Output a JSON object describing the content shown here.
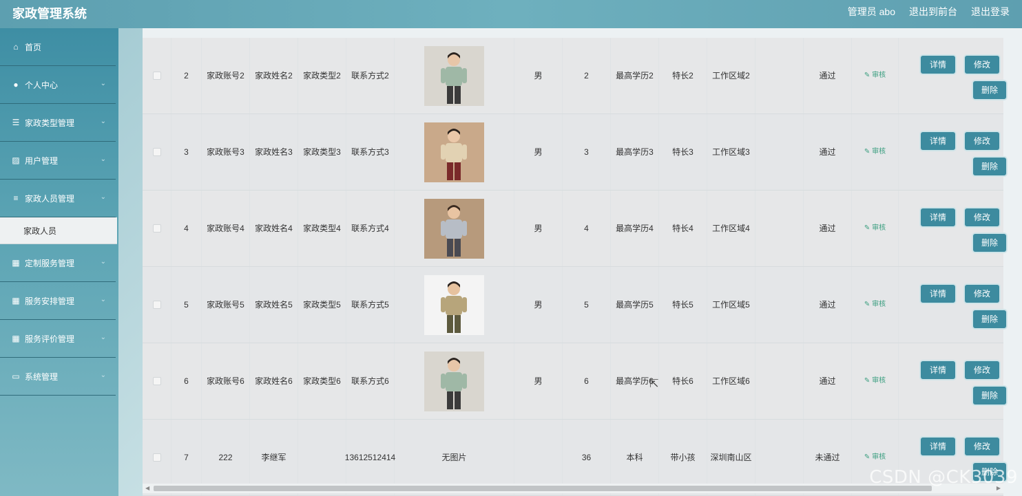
{
  "header": {
    "app_title": "家政管理系统",
    "links": [
      "管理员 abo",
      "退出到前台",
      "退出登录"
    ]
  },
  "sidebar": {
    "items": [
      {
        "label": "首页",
        "icon": "home-icon",
        "glyph": "⌂",
        "chev": false
      },
      {
        "label": "个人中心",
        "icon": "user-icon",
        "glyph": "●",
        "chev": true
      },
      {
        "label": "家政类型管理",
        "icon": "list-icon",
        "glyph": "☰",
        "chev": true
      },
      {
        "label": "用户管理",
        "icon": "chart-icon",
        "glyph": "▨",
        "chev": true
      },
      {
        "label": "家政人员管理",
        "icon": "sliders-icon",
        "glyph": "≡",
        "chev": true
      }
    ],
    "sub_item": "家政人员",
    "items2": [
      {
        "label": "定制服务管理",
        "icon": "grid-icon",
        "glyph": "▦",
        "chev": true
      },
      {
        "label": "服务安排管理",
        "icon": "grid-icon",
        "glyph": "▦",
        "chev": true
      },
      {
        "label": "服务评价管理",
        "icon": "grid-icon",
        "glyph": "▦",
        "chev": true
      },
      {
        "label": "系统管理",
        "icon": "monitor-icon",
        "glyph": "▭",
        "chev": true
      }
    ]
  },
  "table": {
    "audit_label": "✎ 审核",
    "buttons": {
      "detail": "详情",
      "edit": "修改",
      "delete": "删除"
    },
    "rows": [
      {
        "idx": "2",
        "account": [
          "家政账号",
          "2"
        ],
        "name": [
          "家政姓名",
          "2"
        ],
        "type": [
          "家政类型",
          "2"
        ],
        "phone": [
          "联系方式",
          "2"
        ],
        "photo": "p1",
        "gender": "男",
        "age": "2",
        "edu": [
          "最高学历",
          "2"
        ],
        "spec": "特长2",
        "area": [
          "工作区域",
          "2"
        ],
        "status": "通过"
      },
      {
        "idx": "3",
        "account": [
          "家政账号",
          "3"
        ],
        "name": [
          "家政姓名",
          "3"
        ],
        "type": [
          "家政类型",
          "3"
        ],
        "phone": [
          "联系方式",
          "3"
        ],
        "photo": "p2",
        "gender": "男",
        "age": "3",
        "edu": [
          "最高学历",
          "3"
        ],
        "spec": "特长3",
        "area": [
          "工作区域",
          "3"
        ],
        "status": "通过"
      },
      {
        "idx": "4",
        "account": [
          "家政账号",
          "4"
        ],
        "name": [
          "家政姓名",
          "4"
        ],
        "type": [
          "家政类型",
          "4"
        ],
        "phone": [
          "联系方式",
          "4"
        ],
        "photo": "p3",
        "gender": "男",
        "age": "4",
        "edu": [
          "最高学历",
          "4"
        ],
        "spec": "特长4",
        "area": [
          "工作区域",
          "4"
        ],
        "status": "通过"
      },
      {
        "idx": "5",
        "account": [
          "家政账号",
          "5"
        ],
        "name": [
          "家政姓名",
          "5"
        ],
        "type": [
          "家政类型",
          "5"
        ],
        "phone": [
          "联系方式",
          "5"
        ],
        "photo": "p4",
        "gender": "男",
        "age": "5",
        "edu": [
          "最高学历",
          "5"
        ],
        "spec": "特长5",
        "area": [
          "工作区域",
          "5"
        ],
        "status": "通过"
      },
      {
        "idx": "6",
        "account": [
          "家政账号",
          "6"
        ],
        "name": [
          "家政姓名",
          "6"
        ],
        "type": [
          "家政类型",
          "6"
        ],
        "phone": [
          "联系方式",
          "6"
        ],
        "photo": "p1",
        "gender": "男",
        "age": "6",
        "edu": [
          "最高学历",
          "6"
        ],
        "spec": "特长6",
        "area": [
          "工作区域",
          "6"
        ],
        "status": "通过"
      },
      {
        "idx": "7",
        "account": [
          "222"
        ],
        "name": [
          "李继军"
        ],
        "type": [
          ""
        ],
        "phone": [
          "1361251",
          "2414"
        ],
        "photo": "none",
        "photo_text": "无图片",
        "gender": "",
        "age": "36",
        "edu": [
          "本科"
        ],
        "spec": "带小孩",
        "area": [
          "深圳南山",
          "区"
        ],
        "status": "未通过"
      }
    ]
  },
  "watermark": "CSDN @CK3039"
}
